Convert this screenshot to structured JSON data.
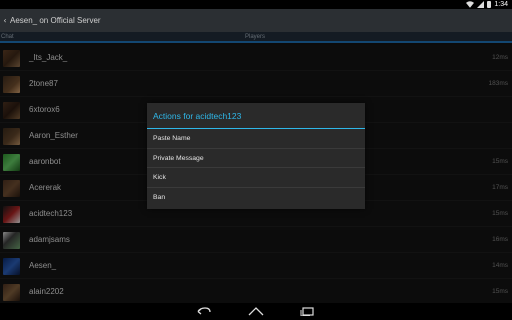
{
  "status_bar": {
    "time": "1:34",
    "icons": [
      "wifi-icon",
      "signal-icon",
      "battery-icon"
    ]
  },
  "action_bar": {
    "title": "Aesen_ on Official Server",
    "up_icon": "chevron-left-icon"
  },
  "tabs": [
    {
      "label": "Chat"
    },
    {
      "label": "Players",
      "selected": true
    }
  ],
  "colors": {
    "accent": "#2fb7e8",
    "tab_indicator": "#1e6eb0",
    "action_bar": "#2b2f33",
    "background": "#131313"
  },
  "players": [
    {
      "name": "_Its_Jack_",
      "ping": "12ms"
    },
    {
      "name": "2tone87",
      "ping": "183ms"
    },
    {
      "name": "6xtorox6",
      "ping": ""
    },
    {
      "name": "Aaron_Esther",
      "ping": ""
    },
    {
      "name": "aaronbot",
      "ping": "15ms"
    },
    {
      "name": "Acererak",
      "ping": "17ms"
    },
    {
      "name": "acidtech123",
      "ping": "15ms"
    },
    {
      "name": "adamjsams",
      "ping": "16ms"
    },
    {
      "name": "Aesen_",
      "ping": "14ms"
    },
    {
      "name": "alain2202",
      "ping": "15ms"
    }
  ],
  "dialog": {
    "title": "Actions for acidtech123",
    "items": [
      "Paste Name",
      "Private Message",
      "Kick",
      "Ban"
    ]
  },
  "nav_bar": {
    "icons": [
      "back-icon",
      "home-icon",
      "recent-apps-icon"
    ]
  }
}
